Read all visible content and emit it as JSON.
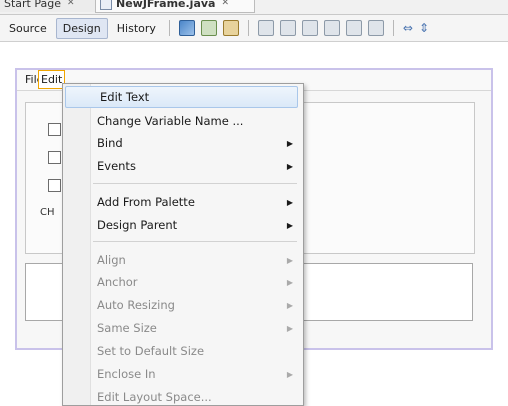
{
  "tabs": [
    {
      "label": "Start Page"
    },
    {
      "label": "NewJFrame.java"
    }
  ],
  "toolbar": {
    "source_label": "Source",
    "design_label": "Design",
    "history_label": "History",
    "icons": [
      "selection-mode-icon",
      "preview-design-icon",
      "palette-icon",
      "align-left-icon",
      "align-right-icon",
      "center-horizontal-icon",
      "align-top-icon",
      "align-bottom-icon",
      "center-vertical-icon",
      "resize-horizontal-icon",
      "resize-vertical-icon"
    ]
  },
  "form": {
    "menubar": {
      "file": "File",
      "edit": "Edit"
    },
    "ch_label": "CH"
  },
  "context_menu": {
    "items": [
      {
        "label": "Edit Text",
        "highlighted": true
      },
      {
        "label": "Change Variable Name ..."
      },
      {
        "label": "Bind",
        "submenu": true
      },
      {
        "label": "Events",
        "submenu": true
      },
      {
        "label": "Add From Palette",
        "submenu": true
      },
      {
        "label": "Design Parent",
        "submenu": true
      },
      {
        "label": "Align",
        "submenu": true,
        "disabled": true
      },
      {
        "label": "Anchor",
        "submenu": true,
        "disabled": true
      },
      {
        "label": "Auto Resizing",
        "submenu": true,
        "disabled": true
      },
      {
        "label": "Same Size",
        "submenu": true,
        "disabled": true
      },
      {
        "label": "Set to Default Size",
        "disabled": true
      },
      {
        "label": "Enclose In",
        "submenu": true,
        "disabled": true
      },
      {
        "label": "Edit Layout Space...",
        "disabled": true
      }
    ]
  }
}
